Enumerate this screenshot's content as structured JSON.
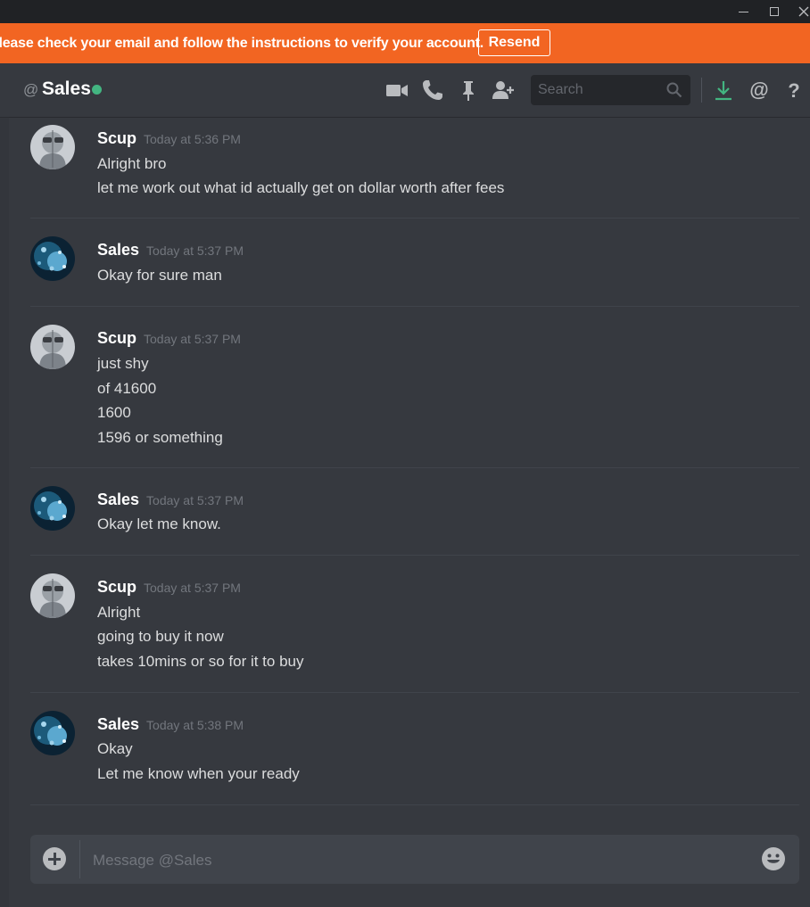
{
  "notice": {
    "text": "Please check your email and follow the instructions to verify your account.",
    "button": "Resend"
  },
  "header": {
    "prefix": "@",
    "channel": "Sales",
    "search_placeholder": "Search",
    "icons": [
      "video-icon",
      "phone-icon",
      "pin-icon",
      "add-friend-icon",
      "search-icon",
      "download-icon",
      "mention-icon",
      "help-icon"
    ]
  },
  "messages": [
    {
      "author": "Scup",
      "time": "Today at 5:36 PM",
      "lines": [
        "Alright bro",
        "let me work out what id actually get on dollar worth after fees"
      ]
    },
    {
      "author": "Sales",
      "time": "Today at 5:37 PM",
      "lines": [
        "Okay for sure man"
      ]
    },
    {
      "author": "Scup",
      "time": "Today at 5:37 PM",
      "lines": [
        "just shy",
        "of 41600",
        "1600",
        "1596 or something"
      ]
    },
    {
      "author": "Sales",
      "time": "Today at 5:37 PM",
      "lines": [
        "Okay let me know."
      ]
    },
    {
      "author": "Scup",
      "time": "Today at 5:37 PM",
      "lines": [
        "Alright",
        "going to buy it now",
        "takes 10mins or so for it to buy"
      ]
    },
    {
      "author": "Sales",
      "time": "Today at 5:38 PM",
      "lines": [
        "Okay",
        "Let me know when your ready"
      ]
    }
  ],
  "composer": {
    "placeholder": "Message @Sales"
  },
  "colors": {
    "notice_bg": "#f26522",
    "online": "#43b581",
    "download": "#43b581",
    "background": "#36393f"
  }
}
